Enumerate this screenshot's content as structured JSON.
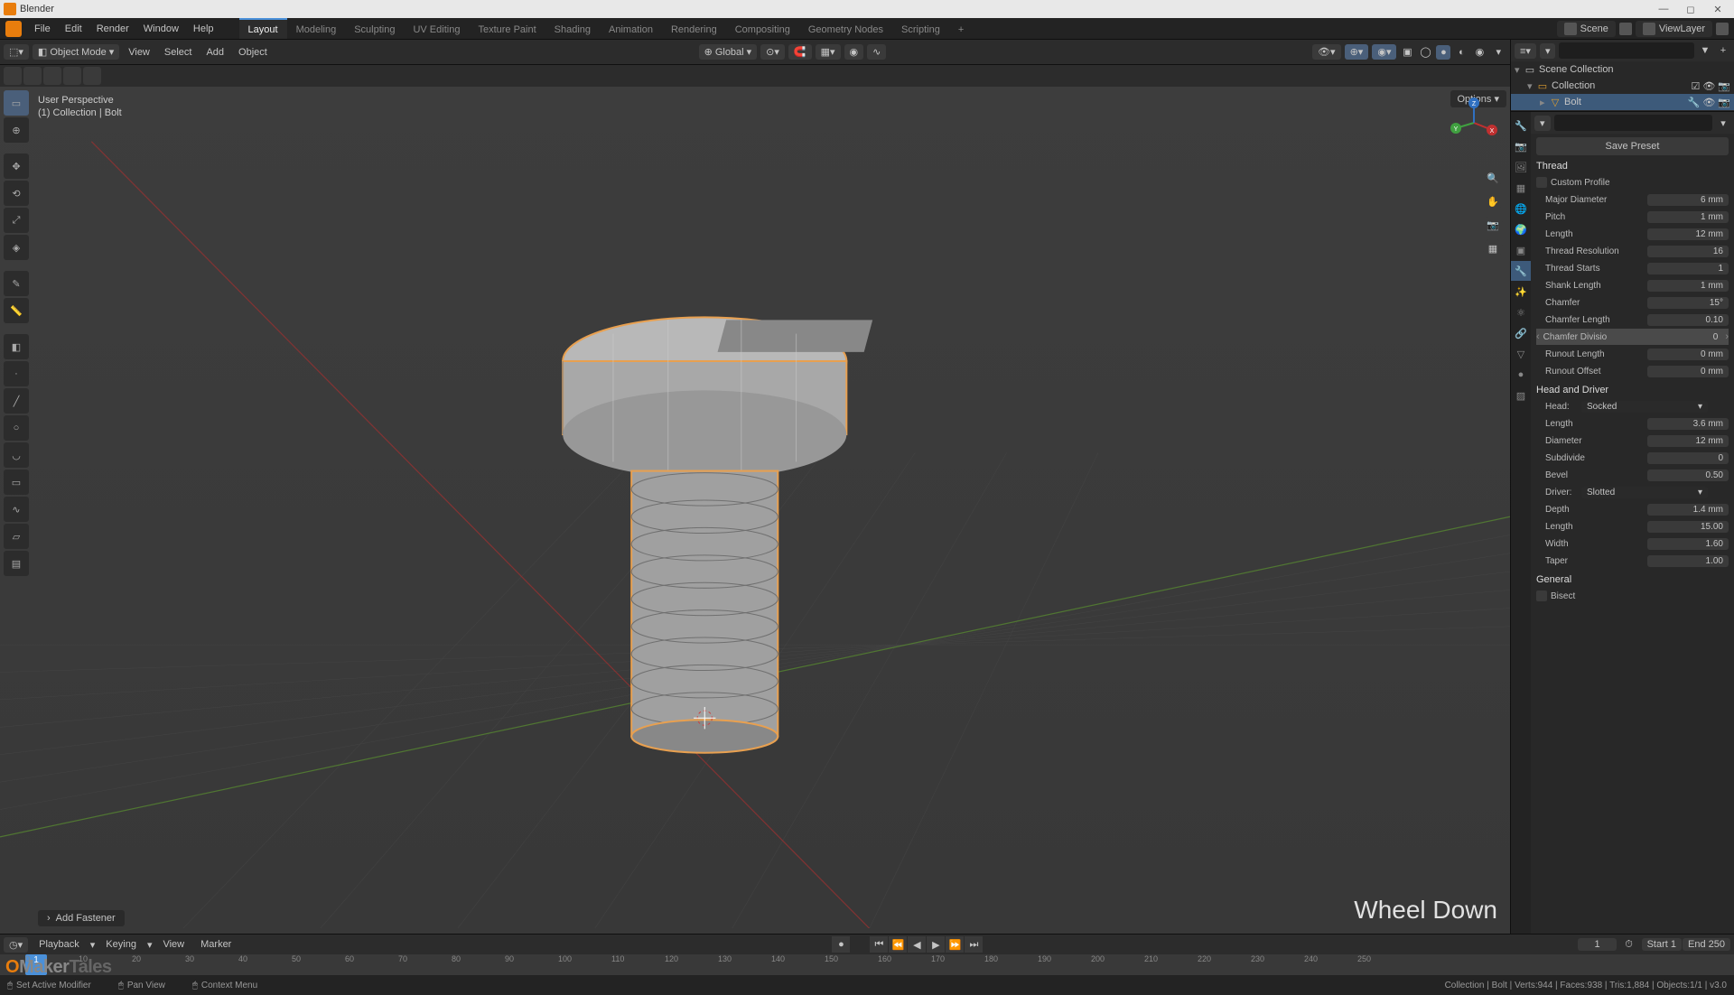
{
  "app": {
    "title": "Blender"
  },
  "menubar": {
    "items": [
      "File",
      "Edit",
      "Render",
      "Window",
      "Help"
    ]
  },
  "workspaces": {
    "tabs": [
      "Layout",
      "Modeling",
      "Sculpting",
      "UV Editing",
      "Texture Paint",
      "Shading",
      "Animation",
      "Rendering",
      "Compositing",
      "Geometry Nodes",
      "Scripting"
    ],
    "active": 0
  },
  "header_right": {
    "scene": "Scene",
    "viewlayer": "ViewLayer"
  },
  "viewport_header": {
    "mode": "Object Mode",
    "menus": [
      "View",
      "Select",
      "Add",
      "Object"
    ],
    "orientation": "Global",
    "options_label": "Options"
  },
  "viewport_overlay": {
    "perspective": "User Perspective",
    "context_line": "(1) Collection | Bolt",
    "last_op": "Add Fastener",
    "mouse_hint": "Wheel Down"
  },
  "outliner": {
    "root": "Scene Collection",
    "collection": "Collection",
    "item": "Bolt"
  },
  "properties": {
    "save_preset": "Save Preset",
    "thread_section": "Thread",
    "custom_profile": "Custom Profile",
    "rows": {
      "major_diameter": {
        "label": "Major Diameter",
        "value": "6 mm"
      },
      "pitch": {
        "label": "Pitch",
        "value": "1 mm"
      },
      "length": {
        "label": "Length",
        "value": "12 mm"
      },
      "thread_resolution": {
        "label": "Thread Resolution",
        "value": "16"
      },
      "thread_starts": {
        "label": "Thread Starts",
        "value": "1"
      },
      "shank_length": {
        "label": "Shank Length",
        "value": "1 mm"
      },
      "chamfer": {
        "label": "Chamfer",
        "value": "15°"
      },
      "chamfer_length": {
        "label": "Chamfer Length",
        "value": "0.10"
      },
      "chamfer_div": {
        "label": "Chamfer Divisio",
        "value": "0"
      },
      "runout_length": {
        "label": "Runout Length",
        "value": "0 mm"
      },
      "runout_offset": {
        "label": "Runout Offset",
        "value": "0 mm"
      }
    },
    "head_section": "Head and Driver",
    "head_label": "Head:",
    "head_value": "Socked",
    "head_rows": {
      "length": {
        "label": "Length",
        "value": "3.6 mm"
      },
      "diameter": {
        "label": "Diameter",
        "value": "12 mm"
      },
      "subdivide": {
        "label": "Subdivide",
        "value": "0"
      },
      "bevel": {
        "label": "Bevel",
        "value": "0.50"
      }
    },
    "driver_label": "Driver:",
    "driver_value": "Slotted",
    "driver_rows": {
      "depth": {
        "label": "Depth",
        "value": "1.4 mm"
      },
      "length": {
        "label": "Length",
        "value": "15.00"
      },
      "width": {
        "label": "Width",
        "value": "1.60"
      },
      "taper": {
        "label": "Taper",
        "value": "1.00"
      }
    },
    "general_section": "General",
    "bisect": "Bisect"
  },
  "timeline": {
    "menus": [
      "Playback",
      "Keying",
      "View",
      "Marker"
    ],
    "current": "1",
    "start_label": "Start",
    "start": "1",
    "end_label": "End",
    "end": "250",
    "ticks": [
      "0",
      "10",
      "20",
      "30",
      "40",
      "50",
      "60",
      "70",
      "80",
      "90",
      "100",
      "110",
      "120",
      "130",
      "140",
      "150",
      "160",
      "170",
      "180",
      "190",
      "200",
      "210",
      "220",
      "230",
      "240",
      "250"
    ]
  },
  "statusbar": {
    "hints": [
      "Set Active Modifier",
      "Pan View",
      "Context Menu"
    ],
    "stats": "Collection | Bolt | Verts:944 | Faces:938 | Tris:1,884 | Objects:1/1 | v3.0"
  },
  "watermark": {
    "a": "O",
    "b": "Maker",
    "c": "Tales"
  }
}
